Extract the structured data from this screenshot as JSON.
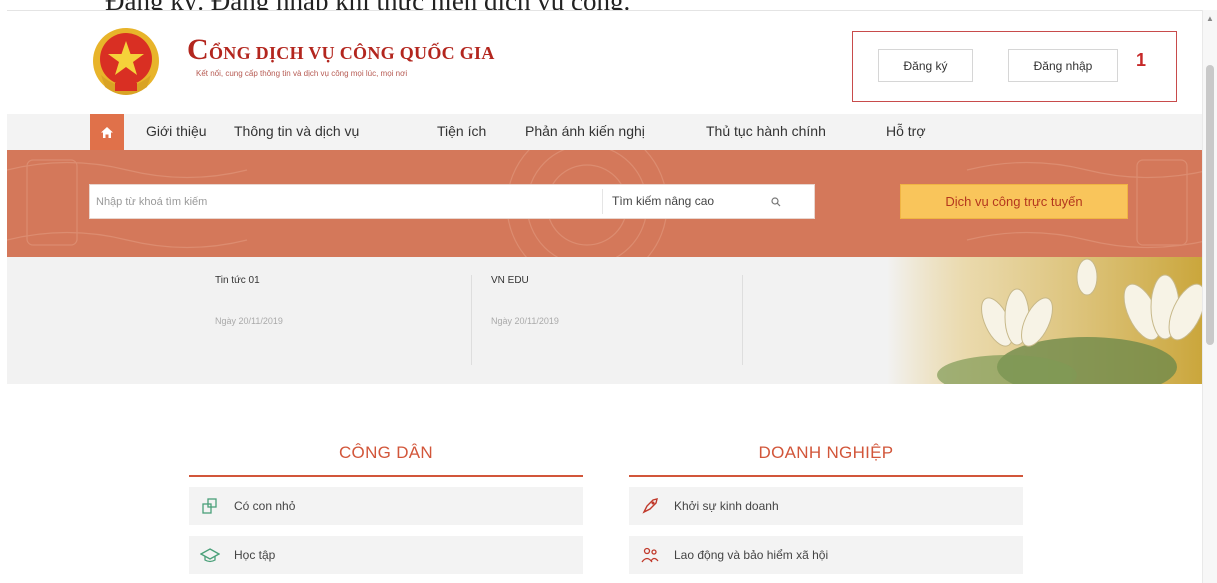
{
  "caption": "Đăng ký. Đăng nhập khi thực hiện dịch vụ công.",
  "brand": {
    "title_initial": "C",
    "title_rest": "ỔNG DỊCH VỤ CÔNG QUỐC GIA",
    "subtitle": "Kết nối, cung cấp thông tin và dịch vụ công mọi lúc, mọi nơi"
  },
  "auth": {
    "register_label": "Đăng ký",
    "login_label": "Đăng nhập",
    "marker": "1"
  },
  "nav": {
    "items": [
      {
        "label": "Giới thiệu"
      },
      {
        "label": "Thông tin và dịch vụ"
      },
      {
        "label": "Tiện ích"
      },
      {
        "label": "Phản ánh kiến nghị"
      },
      {
        "label": "Thủ tục hành chính"
      },
      {
        "label": "Hỗ trợ"
      }
    ]
  },
  "search": {
    "placeholder": "Nhập từ khoá tìm kiếm",
    "advanced_label": "Tìm kiếm nâng cao",
    "online_service_label": "Dịch vụ công trực tuyến"
  },
  "news": [
    {
      "title": "Tin tức 01",
      "date": "Ngày 20/11/2019"
    },
    {
      "title": "VN EDU",
      "date": "Ngày 20/11/2019"
    }
  ],
  "citizen": {
    "title": "CÔNG DÂN",
    "items": [
      {
        "label": "Có con nhỏ",
        "icon": "child-icon"
      },
      {
        "label": "Học tập",
        "icon": "graduation-cap-icon"
      }
    ]
  },
  "business": {
    "title": "DOANH NGHIỆP",
    "items": [
      {
        "label": "Khởi sự kinh doanh",
        "icon": "rocket-icon"
      },
      {
        "label": "Lao động và bảo hiểm xã hội",
        "icon": "workers-icon"
      }
    ]
  },
  "colors": {
    "accent": "#d2563a",
    "banner": "#d4785a",
    "brand_red": "#b3261e",
    "cta_yellow": "#f9c55b"
  }
}
